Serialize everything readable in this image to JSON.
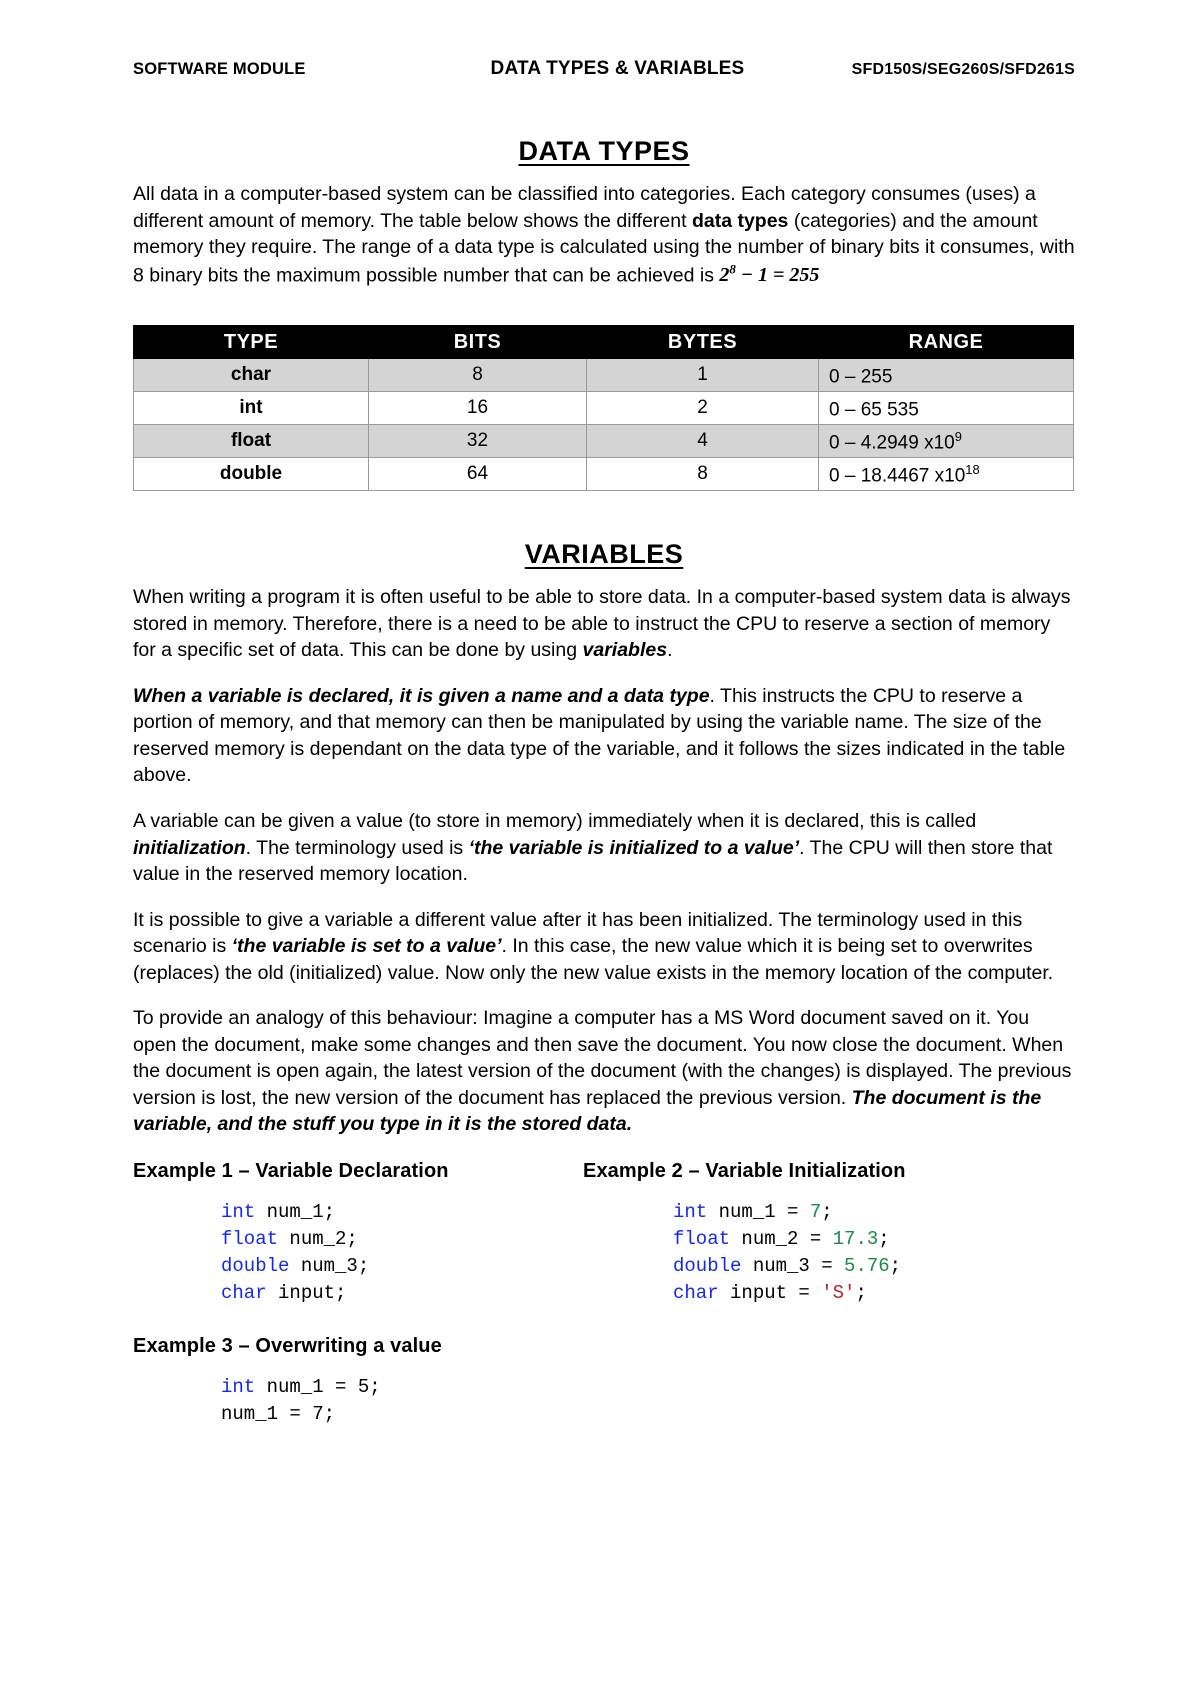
{
  "header": {
    "left": "SOFTWARE MODULE",
    "center": "DATA TYPES & VARIABLES",
    "right": "SFD150S/SEG260S/SFD261S"
  },
  "data_types": {
    "title": "DATA TYPES",
    "intro_1": "All data in a computer-based system can be classified into categories. Each category consumes (uses) a different amount of memory. The table below shows the different ",
    "intro_bold_1": "data types",
    "intro_2": " (categories) and the amount memory they require. The range of a data type is calculated using the number of binary bits it consumes, with 8 binary bits the maximum possible number that can be achieved is ",
    "intro_math": "2",
    "intro_math_sup": "8",
    "intro_math_tail": " − 1 = 255"
  },
  "table": {
    "columns": [
      "TYPE",
      "BITS",
      "BYTES",
      "RANGE"
    ],
    "rows": [
      {
        "type": "char",
        "bits": "8",
        "bytes": "1",
        "range": "0 – 255",
        "range_sup": ""
      },
      {
        "type": "int",
        "bits": "16",
        "bytes": "2",
        "range": "0 – 65 535",
        "range_sup": ""
      },
      {
        "type": "float",
        "bits": "32",
        "bytes": "4",
        "range": "0 – 4.2949 x10",
        "range_sup": "9"
      },
      {
        "type": "double",
        "bits": "64",
        "bytes": "8",
        "range": "0 – 18.4467 x10",
        "range_sup": "18"
      }
    ]
  },
  "variables": {
    "title": "VARIABLES",
    "p1_a": "When writing a program it is often useful to be able to store data. In a computer-based system data is always stored in memory. Therefore, there is a need to be able to instruct the CPU to reserve a section of memory for a specific set of data. This can be done by using ",
    "p1_bi": "variables",
    "p1_b": ".",
    "p2_bi": "When a variable is declared, it is given a name and a data type",
    "p2_a": ". This instructs the CPU to reserve a portion of memory, and that memory can then be manipulated by using the variable name. The size of the reserved memory is dependant on the data type of the variable, and it follows the sizes indicated in the table above.",
    "p3_a": "A variable can be given a value (to store in memory) immediately when it is declared, this is called ",
    "p3_bi1": "initialization",
    "p3_b": ". The terminology used is ",
    "p3_bi2": "‘the variable is initialized to a value’",
    "p3_c": ". The CPU will then store that value in the reserved memory location.",
    "p4_a": "It is possible to give a variable a different value after it has been initialized. The terminology used in this scenario is ",
    "p4_bi": "‘the variable is set to a value’",
    "p4_b": ". In this case, the new value which it is being set to overwrites (replaces) the old (initialized) value. Now only the new value exists in the memory location of the computer.",
    "p5_a": "To provide an analogy of this behaviour: Imagine a computer has a MS Word document saved on it. You open the document, make some changes and then save the document. You now close the document. When the document is open again, the latest version of the document (with the changes) is displayed. The previous version is lost, the new version of the document has replaced the previous version. ",
    "p5_bi": "The document is the variable, and the stuff you type in it is the stored data."
  },
  "examples": {
    "ex1": {
      "title": "Example 1 – Variable Declaration",
      "lines": [
        [
          {
            "t": "int",
            "c": "kw"
          },
          {
            "t": " num_1;",
            "c": "plain"
          }
        ],
        [
          {
            "t": "float",
            "c": "kw"
          },
          {
            "t": " num_2;",
            "c": "plain"
          }
        ],
        [
          {
            "t": "double",
            "c": "kw"
          },
          {
            "t": " num_3;",
            "c": "plain"
          }
        ],
        [
          {
            "t": "char",
            "c": "kw"
          },
          {
            "t": " input;",
            "c": "plain"
          }
        ]
      ]
    },
    "ex2": {
      "title": "Example 2 – Variable Initialization",
      "lines": [
        [
          {
            "t": "int",
            "c": "kw"
          },
          {
            "t": " num_1 = ",
            "c": "plain"
          },
          {
            "t": "7",
            "c": "num"
          },
          {
            "t": ";",
            "c": "plain"
          }
        ],
        [
          {
            "t": "float",
            "c": "kw"
          },
          {
            "t": " num_2 = ",
            "c": "plain"
          },
          {
            "t": "17.3",
            "c": "num"
          },
          {
            "t": ";",
            "c": "plain"
          }
        ],
        [
          {
            "t": "double",
            "c": "kw"
          },
          {
            "t": " num_3 = ",
            "c": "plain"
          },
          {
            "t": "5.76",
            "c": "num"
          },
          {
            "t": ";",
            "c": "plain"
          }
        ],
        [
          {
            "t": "char",
            "c": "kw"
          },
          {
            "t": " input = ",
            "c": "plain"
          },
          {
            "t": "'S'",
            "c": "str"
          },
          {
            "t": ";",
            "c": "plain"
          }
        ]
      ]
    },
    "ex3": {
      "title": "Example 3 – Overwriting a value",
      "lines": [
        [
          {
            "t": "int",
            "c": "kw"
          },
          {
            "t": " num_1 = 5;",
            "c": "plain"
          }
        ],
        [
          {
            "t": "num_1 = 7;",
            "c": "plain"
          }
        ]
      ]
    }
  }
}
